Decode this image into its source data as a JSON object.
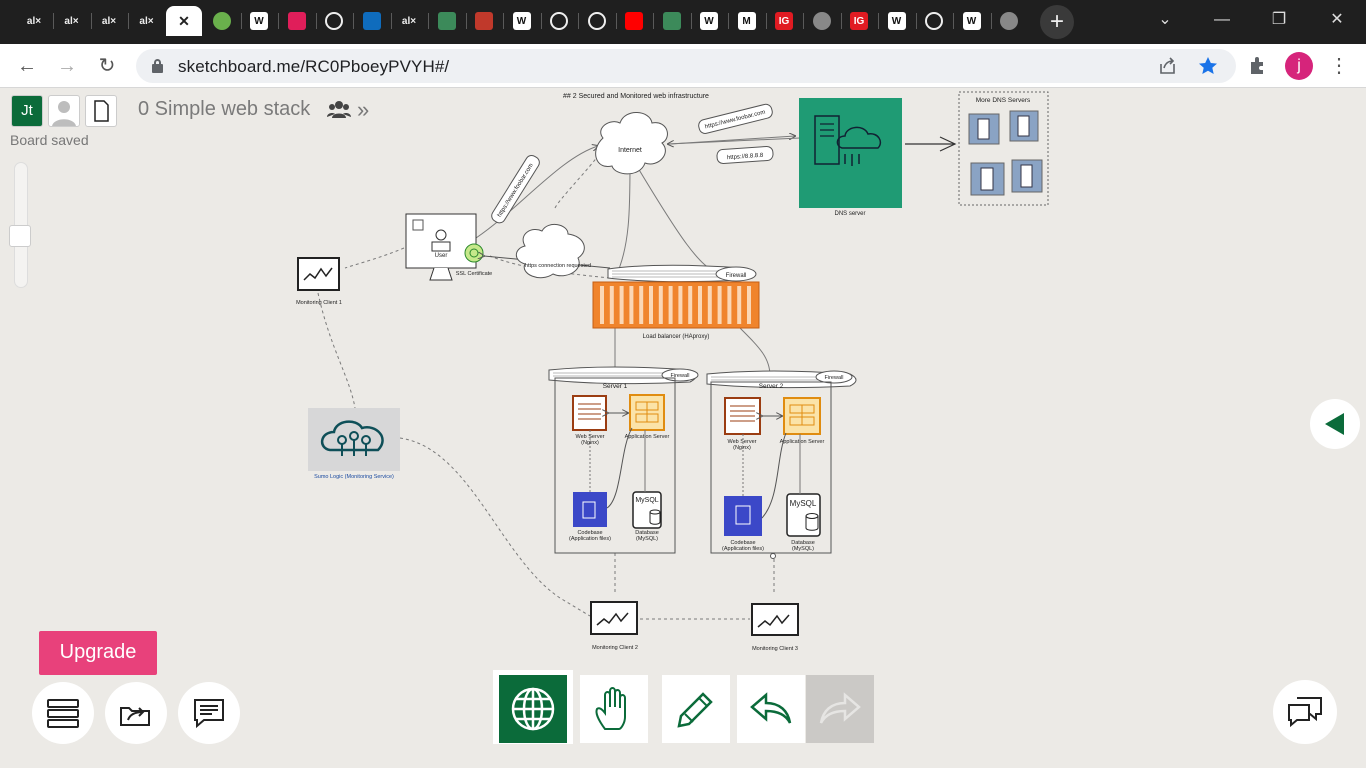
{
  "browser": {
    "tabs": [
      {
        "icon": "alx-icon",
        "label": "al×"
      },
      {
        "icon": "alx-icon",
        "label": "al×"
      },
      {
        "icon": "alx-icon",
        "label": "al×"
      },
      {
        "icon": "alx-icon",
        "label": "al×"
      },
      {
        "icon": "close-icon",
        "label": "✕",
        "active": true
      },
      {
        "icon": "green-circle-icon",
        "label": ""
      },
      {
        "icon": "wikipedia-icon",
        "label": "W"
      },
      {
        "icon": "slack-icon",
        "label": ""
      },
      {
        "icon": "github-icon",
        "label": ""
      },
      {
        "icon": "onedrive-icon",
        "label": ""
      },
      {
        "icon": "alx-icon",
        "label": "al×"
      },
      {
        "icon": "diamond-icon",
        "label": ""
      },
      {
        "icon": "boat-icon",
        "label": ""
      },
      {
        "icon": "wikipedia-icon",
        "label": "W"
      },
      {
        "icon": "github-icon",
        "label": ""
      },
      {
        "icon": "github-icon",
        "label": ""
      },
      {
        "icon": "youtube-icon",
        "label": ""
      },
      {
        "icon": "diamond-icon",
        "label": ""
      },
      {
        "icon": "wikipedia-icon",
        "label": "W"
      },
      {
        "icon": "gmail-icon",
        "label": "M"
      },
      {
        "icon": "ig-icon",
        "label": "IG"
      },
      {
        "icon": "circle-c-icon",
        "label": ""
      },
      {
        "icon": "ig-icon",
        "label": "IG"
      },
      {
        "icon": "wikipedia-icon",
        "label": "W"
      },
      {
        "icon": "github-icon",
        "label": ""
      },
      {
        "icon": "wikipedia-icon",
        "label": "W"
      },
      {
        "icon": "globe-icon",
        "label": ""
      }
    ],
    "new_tab": "+",
    "url": "sketchboard.me/RC0PboeyPVYH#/",
    "profile_initial": "j"
  },
  "app": {
    "user_initials": "Jt",
    "board_title": "0 Simple web stack",
    "status": "Board saved",
    "upgrade_label": "Upgrade"
  },
  "diagram": {
    "heading": "## 2 Secured and Monitored web infrastructure",
    "internet": "Internet",
    "dns_server": "DNS server",
    "more_dns": "More DNS Servers",
    "url_1": "https://www.foobar.com",
    "url_2": "https://8.8.8.8",
    "url_3": "https://www.foobar.com",
    "user": "User",
    "ssl": "SSL Certificate",
    "https_request": "https connection requested",
    "firewall": "Firewall",
    "load_balancer": "Load balancer (HAproxy)",
    "monitoring_1": "Monitoring Client 1",
    "monitoring_2": "Monitoring Client 2",
    "monitoring_3": "Monitoring Client 3",
    "sumo": "Sumo Logic (Monitoring Service)",
    "server_1": "Server 1",
    "server_2": "Server 2",
    "web_server": "Web Server",
    "nginx": "(Nginx)",
    "app_server": "Application Server",
    "codebase": "Codebase",
    "app_files": "(Application files)",
    "database": "Database",
    "mysql": "(MySQL)",
    "mysql_logo": "MySQL"
  },
  "colors": {
    "accent_green": "#0b6b3a",
    "upgrade_pink": "#e8417b",
    "lb_orange": "#f0842c",
    "dns_teal": "#1f9b74"
  }
}
